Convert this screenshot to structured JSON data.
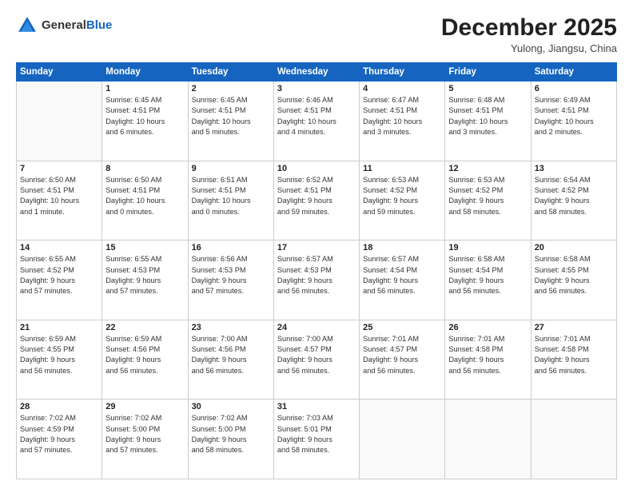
{
  "header": {
    "logo_general": "General",
    "logo_blue": "Blue",
    "month": "December 2025",
    "location": "Yulong, Jiangsu, China"
  },
  "columns": [
    "Sunday",
    "Monday",
    "Tuesday",
    "Wednesday",
    "Thursday",
    "Friday",
    "Saturday"
  ],
  "weeks": [
    [
      {
        "day": "",
        "info": ""
      },
      {
        "day": "1",
        "info": "Sunrise: 6:45 AM\nSunset: 4:51 PM\nDaylight: 10 hours\nand 6 minutes."
      },
      {
        "day": "2",
        "info": "Sunrise: 6:45 AM\nSunset: 4:51 PM\nDaylight: 10 hours\nand 5 minutes."
      },
      {
        "day": "3",
        "info": "Sunrise: 6:46 AM\nSunset: 4:51 PM\nDaylight: 10 hours\nand 4 minutes."
      },
      {
        "day": "4",
        "info": "Sunrise: 6:47 AM\nSunset: 4:51 PM\nDaylight: 10 hours\nand 3 minutes."
      },
      {
        "day": "5",
        "info": "Sunrise: 6:48 AM\nSunset: 4:51 PM\nDaylight: 10 hours\nand 3 minutes."
      },
      {
        "day": "6",
        "info": "Sunrise: 6:49 AM\nSunset: 4:51 PM\nDaylight: 10 hours\nand 2 minutes."
      }
    ],
    [
      {
        "day": "7",
        "info": "Sunrise: 6:50 AM\nSunset: 4:51 PM\nDaylight: 10 hours\nand 1 minute."
      },
      {
        "day": "8",
        "info": "Sunrise: 6:50 AM\nSunset: 4:51 PM\nDaylight: 10 hours\nand 0 minutes."
      },
      {
        "day": "9",
        "info": "Sunrise: 6:51 AM\nSunset: 4:51 PM\nDaylight: 10 hours\nand 0 minutes."
      },
      {
        "day": "10",
        "info": "Sunrise: 6:52 AM\nSunset: 4:51 PM\nDaylight: 9 hours\nand 59 minutes."
      },
      {
        "day": "11",
        "info": "Sunrise: 6:53 AM\nSunset: 4:52 PM\nDaylight: 9 hours\nand 59 minutes."
      },
      {
        "day": "12",
        "info": "Sunrise: 6:53 AM\nSunset: 4:52 PM\nDaylight: 9 hours\nand 58 minutes."
      },
      {
        "day": "13",
        "info": "Sunrise: 6:54 AM\nSunset: 4:52 PM\nDaylight: 9 hours\nand 58 minutes."
      }
    ],
    [
      {
        "day": "14",
        "info": "Sunrise: 6:55 AM\nSunset: 4:52 PM\nDaylight: 9 hours\nand 57 minutes."
      },
      {
        "day": "15",
        "info": "Sunrise: 6:55 AM\nSunset: 4:53 PM\nDaylight: 9 hours\nand 57 minutes."
      },
      {
        "day": "16",
        "info": "Sunrise: 6:56 AM\nSunset: 4:53 PM\nDaylight: 9 hours\nand 57 minutes."
      },
      {
        "day": "17",
        "info": "Sunrise: 6:57 AM\nSunset: 4:53 PM\nDaylight: 9 hours\nand 56 minutes."
      },
      {
        "day": "18",
        "info": "Sunrise: 6:57 AM\nSunset: 4:54 PM\nDaylight: 9 hours\nand 56 minutes."
      },
      {
        "day": "19",
        "info": "Sunrise: 6:58 AM\nSunset: 4:54 PM\nDaylight: 9 hours\nand 56 minutes."
      },
      {
        "day": "20",
        "info": "Sunrise: 6:58 AM\nSunset: 4:55 PM\nDaylight: 9 hours\nand 56 minutes."
      }
    ],
    [
      {
        "day": "21",
        "info": "Sunrise: 6:59 AM\nSunset: 4:55 PM\nDaylight: 9 hours\nand 56 minutes."
      },
      {
        "day": "22",
        "info": "Sunrise: 6:59 AM\nSunset: 4:56 PM\nDaylight: 9 hours\nand 56 minutes."
      },
      {
        "day": "23",
        "info": "Sunrise: 7:00 AM\nSunset: 4:56 PM\nDaylight: 9 hours\nand 56 minutes."
      },
      {
        "day": "24",
        "info": "Sunrise: 7:00 AM\nSunset: 4:57 PM\nDaylight: 9 hours\nand 56 minutes."
      },
      {
        "day": "25",
        "info": "Sunrise: 7:01 AM\nSunset: 4:57 PM\nDaylight: 9 hours\nand 56 minutes."
      },
      {
        "day": "26",
        "info": "Sunrise: 7:01 AM\nSunset: 4:58 PM\nDaylight: 9 hours\nand 56 minutes."
      },
      {
        "day": "27",
        "info": "Sunrise: 7:01 AM\nSunset: 4:58 PM\nDaylight: 9 hours\nand 56 minutes."
      }
    ],
    [
      {
        "day": "28",
        "info": "Sunrise: 7:02 AM\nSunset: 4:59 PM\nDaylight: 9 hours\nand 57 minutes."
      },
      {
        "day": "29",
        "info": "Sunrise: 7:02 AM\nSunset: 5:00 PM\nDaylight: 9 hours\nand 57 minutes."
      },
      {
        "day": "30",
        "info": "Sunrise: 7:02 AM\nSunset: 5:00 PM\nDaylight: 9 hours\nand 58 minutes."
      },
      {
        "day": "31",
        "info": "Sunrise: 7:03 AM\nSunset: 5:01 PM\nDaylight: 9 hours\nand 58 minutes."
      },
      {
        "day": "",
        "info": ""
      },
      {
        "day": "",
        "info": ""
      },
      {
        "day": "",
        "info": ""
      }
    ]
  ]
}
